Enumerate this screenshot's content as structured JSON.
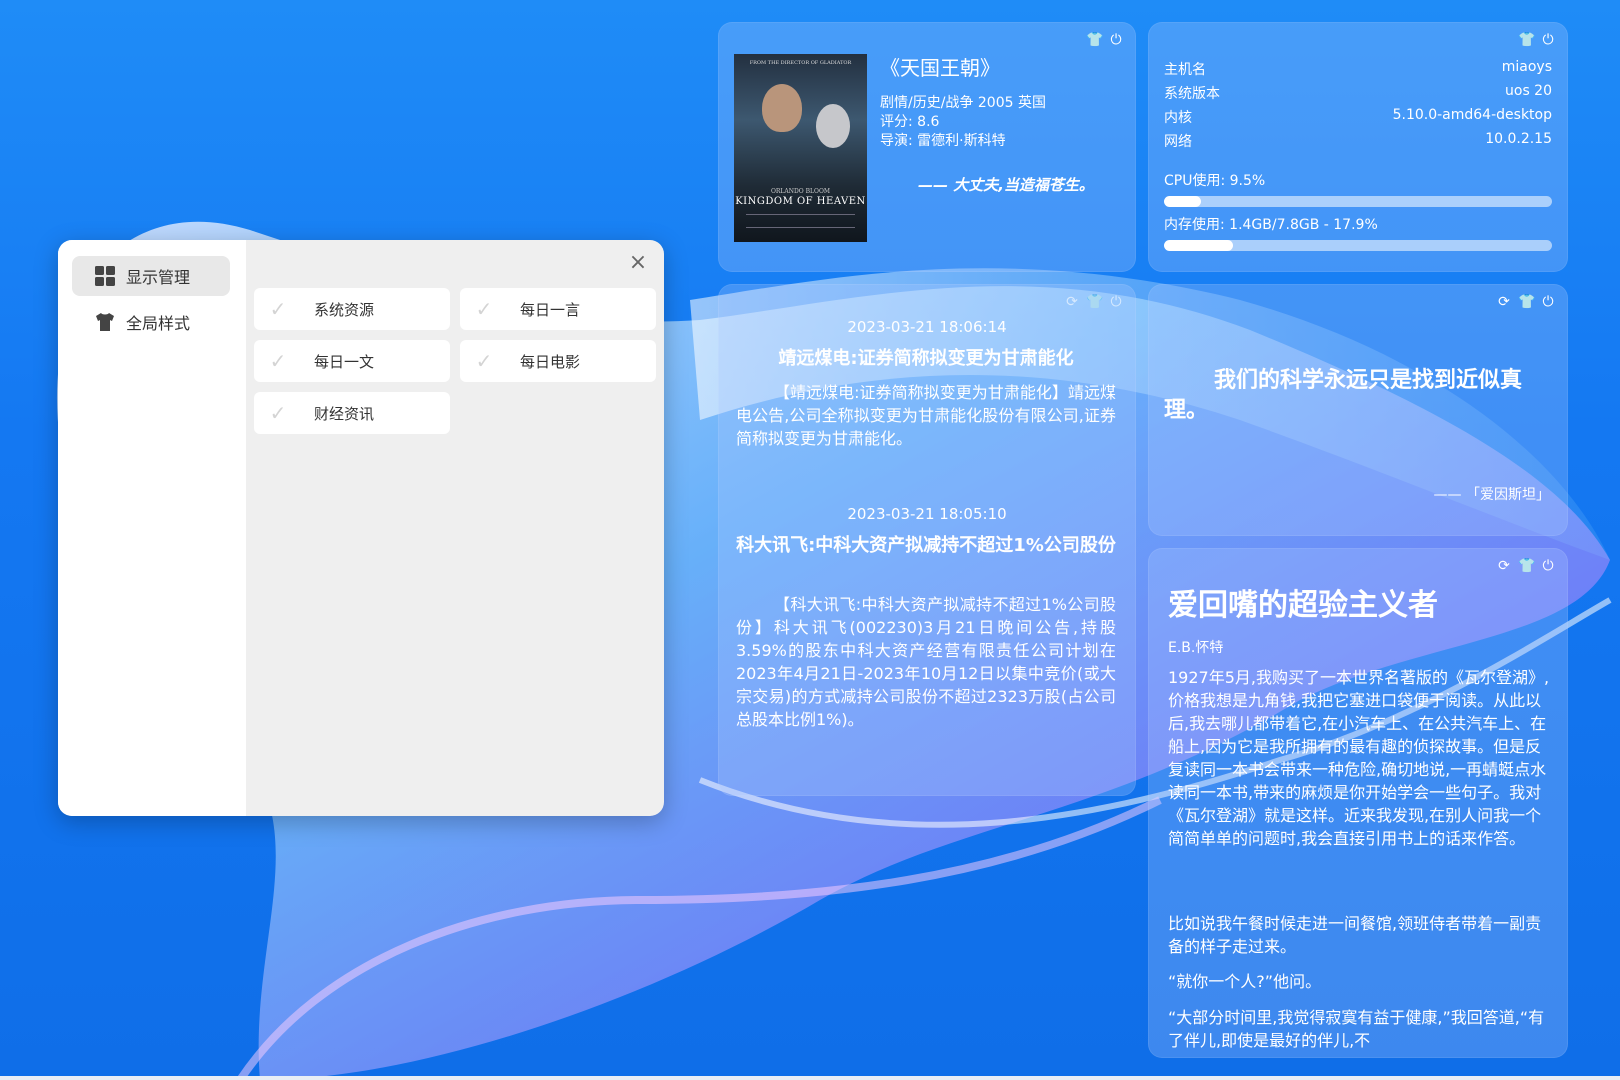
{
  "dialog": {
    "sidebar": [
      {
        "label": "显示管理",
        "icon": "grid-icon",
        "active": true
      },
      {
        "label": "全局样式",
        "icon": "tshirt-icon",
        "active": false
      }
    ],
    "close_icon": "close-icon",
    "options": [
      {
        "label": "系统资源",
        "icon": "check-icon"
      },
      {
        "label": "每日一言",
        "icon": "check-icon"
      },
      {
        "label": "每日一文",
        "icon": "check-icon"
      },
      {
        "label": "每日电影",
        "icon": "check-icon"
      },
      {
        "label": "财经资讯",
        "icon": "check-icon"
      }
    ]
  },
  "movie": {
    "poster": {
      "tagline": "FROM THE DIRECTOR OF GLADIATOR",
      "actor": "ORLANDO BLOOM",
      "title": "KINGDOM OF HEAVEN"
    },
    "title": "《天国王朝》",
    "genre_line": "剧情/历史/战争  2005  英国",
    "rating_line": "评分:  8.6",
    "director_line": "导演:  雷德利·斯科特",
    "quote": "—— 大丈夫,当造福苍生。",
    "tools": [
      "tshirt-icon",
      "power-icon"
    ]
  },
  "system": {
    "tools": [
      "tshirt-icon",
      "power-icon"
    ],
    "rows": [
      {
        "label": "主机名",
        "value": "miaoys"
      },
      {
        "label": "系统版本",
        "value": "uos 20"
      },
      {
        "label": "内核",
        "value": "5.10.0-amd64-desktop"
      },
      {
        "label": "网络",
        "value": "10.0.2.15"
      }
    ],
    "cpu_label": "CPU使用:  9.5%",
    "cpu_fraction": 0.095,
    "mem_label": "内存使用:  1.4GB/7.8GB - 17.9%",
    "mem_fraction": 0.179
  },
  "news": {
    "items": [
      {
        "time": "2023-03-21 18:06:14",
        "headline": "靖远煤电:证券简称拟变更为甘肃能化",
        "body": "【靖远煤电:证券简称拟变更为甘肃能化】靖远煤电公告,公司全称拟变更为甘肃能化股份有限公司,证券简称拟变更为甘肃能化。"
      },
      {
        "time": "2023-03-21 18:05:10",
        "headline": "科大讯飞:中科大资产拟减持不超过1%公司股份",
        "body": "【科大讯飞:中科大资产拟减持不超过1%公司股份】科大讯飞(002230)3月21日晚间公告,持股3.59%的股东中科大资产经营有限责任公司计划在2023年4月21日-2023年10月12日以集中竞价(或大宗交易)的方式减持公司股份不超过2323万股(占公司总股本比例1%)。"
      }
    ]
  },
  "quote": {
    "tools": [
      "refresh-icon",
      "tshirt-icon",
      "power-icon"
    ],
    "text": "我们的科学永远只是找到近似真理。",
    "author": "—— 「爱因斯坦」"
  },
  "article": {
    "tools": [
      "refresh-icon",
      "tshirt-icon",
      "power-icon"
    ],
    "title": "爱回嘴的超验主义者",
    "author": "E.B.怀特",
    "paragraphs": [
      "1927年5月,我购买了一本世界名著版的《瓦尔登湖》,价格我想是九角钱,我把它塞进口袋便于阅读。从此以后,我去哪儿都带着它,在小汽车上、在公共汽车上、在船上,因为它是我所拥有的最有趣的侦探故事。但是反复读同一本书会带来一种危险,确切地说,一再蜻蜓点水读同一本书,带来的麻烦是你开始学会一些句子。我对《瓦尔登湖》就是这样。近来我发现,在别人问我一个简简单单的问题时,我会直接引用书上的话来作答。",
      "比如说我午餐时候走进一间餐馆,领班侍者带着一副责备的样子走过来。",
      "“就你一个人?”他问。",
      "“大部分时间里,我觉得寂寞有益于健康,”我回答道,“有了伴儿,即使是最好的伴儿,不"
    ]
  }
}
